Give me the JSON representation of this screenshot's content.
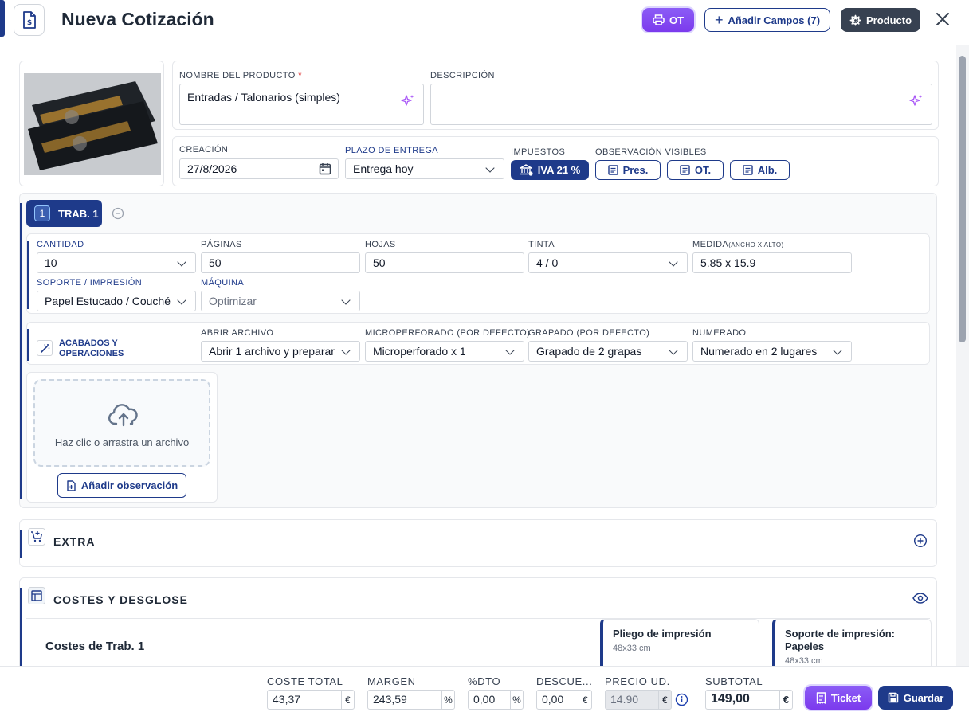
{
  "header": {
    "title": "Nueva Cotización",
    "ot_label": "OT",
    "add_fields_label": "Añadir Campos (7)",
    "product_label": "Producto"
  },
  "product": {
    "name_label": "NOMBRE DEL PRODUCTO",
    "name_required": "*",
    "name_value": "Entradas / Talonarios (simples)",
    "description_label": "DESCRIPCIÓN",
    "description_value": "",
    "creation_label": "CREACIÓN",
    "creation_value": "27/8/2026",
    "delivery_label": "PLAZO DE ENTREGA",
    "delivery_value": "Entrega hoy",
    "taxes_label": "IMPUESTOS",
    "tax_value": "IVA 21 %",
    "obs_label": "OBSERVACIÓN VISIBLES",
    "obs_pres": "Pres.",
    "obs_ot": "OT.",
    "obs_alb": "Alb."
  },
  "job": {
    "number": "1",
    "tab_label": "TRAB. 1",
    "quantity_label": "CANTIDAD",
    "quantity_value": "10",
    "pages_label": "PÁGINAS",
    "pages_value": "50",
    "sheets_label": "HOJAS",
    "sheets_value": "50",
    "ink_label": "TINTA",
    "ink_value": "4 / 0",
    "measure_label": "MEDIDA",
    "measure_sub": "(ANCHO X ALTO)",
    "measure_value": "5.85 x 15.9",
    "support_label": "SOPORTE / IMPRESIÓN",
    "support_value": "Papel Estucado / Couché",
    "machine_label": "MÁQUINA",
    "machine_placeholder": "Optimizar",
    "finishes_label": "ACABADOS Y OPERACIONES",
    "open_file_label": "ABRIR ARCHIVO",
    "open_file_value": "Abrir 1 archivo y preparar",
    "microperf_label": "MICROPERFORADO (POR DEFECTO)",
    "microperf_value": "Microperforado x 1",
    "stapled_label": "GRAPADO (POR DEFECTO)",
    "stapled_value": "Grapado de 2 grapas",
    "numbered_label": "NUMERADO",
    "numbered_value": "Numerado en 2 lugares",
    "upload_text": "Haz clic o arrastra un archivo",
    "add_observation": "Añadir observación"
  },
  "extra": {
    "title": "EXTRA"
  },
  "costs": {
    "title": "COSTES Y DESGLOSE",
    "subtitle": "Costes de Trab. 1",
    "card1_title": "Pliego de impresión",
    "card1_sub": "48x33 cm",
    "card2_title": "Soporte de impresión: Papeles",
    "card2_sub": "48x33 cm"
  },
  "footer": {
    "total_cost_label": "COSTE TOTAL",
    "total_cost_value": "43,37",
    "total_cost_unit": "€",
    "margin_label": "MARGEN",
    "margin_value": "243,59",
    "margin_unit": "%",
    "dto_label": "%DTO",
    "dto_value": "0,00",
    "dto_unit": "%",
    "discount_label": "DESCUE...",
    "discount_value": "0,00",
    "discount_unit": "€",
    "unit_price_label": "PRECIO UD.",
    "unit_price_value": "14.90",
    "unit_price_unit": "€",
    "subtotal_label": "SUBTOTAL",
    "subtotal_value": "149,00",
    "subtotal_unit": "€",
    "ticket_label": "Ticket",
    "save_label": "Guardar"
  },
  "colors": {
    "primary": "#1e3a8a",
    "accent": "#7c3aed"
  }
}
